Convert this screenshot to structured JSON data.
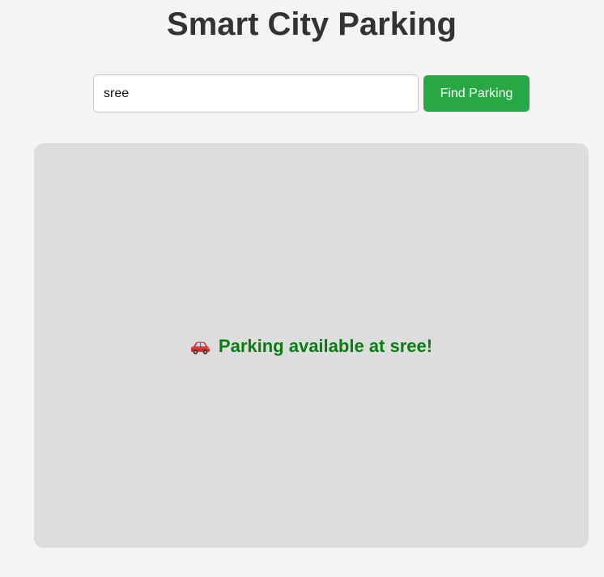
{
  "header": {
    "title": "Smart City Parking"
  },
  "search": {
    "value": "sree",
    "button_label": "Find Parking"
  },
  "result": {
    "icon": "car-icon",
    "message": "Parking available at sree!"
  },
  "colors": {
    "background": "#f4f4f4",
    "button": "#28a745",
    "panel": "#dddddd",
    "status_text": "#0a7d12",
    "title_text": "#333333"
  }
}
